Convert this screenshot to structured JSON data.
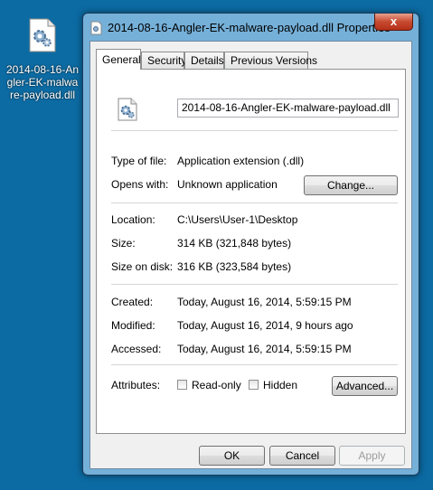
{
  "desktop": {
    "file_label": "2014-08-16-Angler-EK-malware-payload.dll",
    "file_icon": "dll-file-icon"
  },
  "window": {
    "title": "2014-08-16-Angler-EK-malware-payload.dll Properties",
    "close_glyph": "x"
  },
  "tabs": [
    {
      "label": "General",
      "active": true
    },
    {
      "label": "Security"
    },
    {
      "label": "Details"
    },
    {
      "label": "Previous Versions"
    }
  ],
  "general": {
    "filename": "2014-08-16-Angler-EK-malware-payload.dll",
    "type_label": "Type of file:",
    "type_value": "Application extension (.dll)",
    "opens_label": "Opens with:",
    "opens_value": "Unknown application",
    "change_label": "Change...",
    "location_label": "Location:",
    "location_value": "C:\\Users\\User-1\\Desktop",
    "size_label": "Size:",
    "size_value": "314 KB (321,848 bytes)",
    "sizeondisk_label": "Size on disk:",
    "sizeondisk_value": "316 KB (323,584 bytes)",
    "created_label": "Created:",
    "created_value": "Today, August 16, 2014, 5:59:15 PM",
    "modified_label": "Modified:",
    "modified_value": "Today, August 16, 2014, 9 hours ago",
    "accessed_label": "Accessed:",
    "accessed_value": "Today, August 16, 2014, 5:59:15 PM",
    "attributes_label": "Attributes:",
    "readonly_label": "Read-only",
    "hidden_label": "Hidden",
    "advanced_label": "Advanced..."
  },
  "footer": {
    "ok_label": "OK",
    "cancel_label": "Cancel",
    "apply_label": "Apply"
  }
}
